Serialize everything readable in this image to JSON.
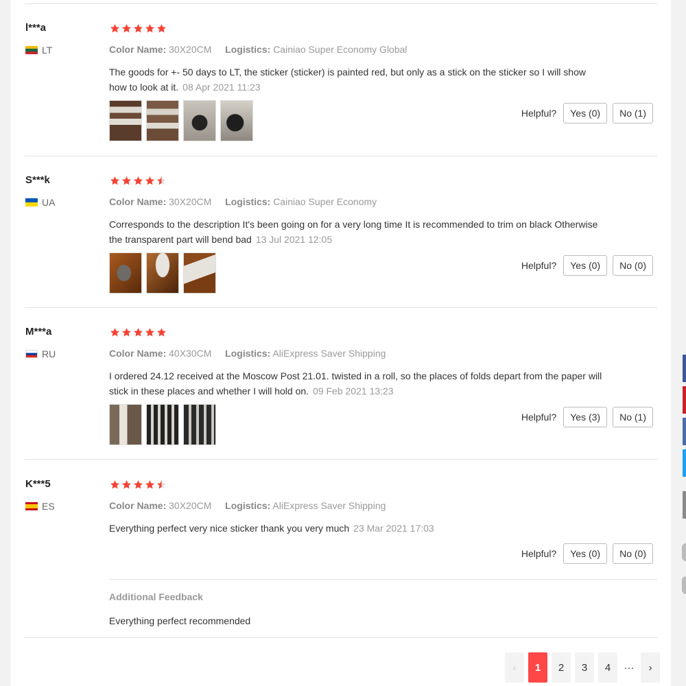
{
  "helpful_label": "Helpful?",
  "reviews": [
    {
      "user": "l***a",
      "country": "LT",
      "meta_color_label": "Color Name:",
      "color": "30X20CM",
      "meta_logistics_label": "Logistics:",
      "logistics": "Cainiao Super Economy Global",
      "text": "The goods for +- 50 days to LT, the sticker (sticker) is painted red, but only as a stick on the sticker so I will show how to look at it.",
      "date": "08 Apr 2021 11:23",
      "stars": 5,
      "yes": "Yes (0)",
      "no": "No (1)"
    },
    {
      "user": "S***k",
      "country": "UA",
      "meta_color_label": "Color Name:",
      "color": "30X20CM",
      "meta_logistics_label": "Logistics:",
      "logistics": "Cainiao Super Economy",
      "text": "Corresponds to the description It's been going on for a very long time It is recommended to trim on black Otherwise the transparent part will bend bad",
      "date": "13 Jul 2021 12:05",
      "stars": 4.5,
      "yes": "Yes (0)",
      "no": "No (0)"
    },
    {
      "user": "M***a",
      "country": "RU",
      "meta_color_label": "Color Name:",
      "color": "40X30CM",
      "meta_logistics_label": "Logistics:",
      "logistics": "AliExpress Saver Shipping",
      "text": "I ordered 24.12 received at the Moscow Post 21.01. twisted in a roll, so the places of folds depart from the paper will stick in these places and whether I will hold on.",
      "date": "09 Feb 2021 13:23",
      "stars": 5,
      "yes": "Yes (3)",
      "no": "No (1)"
    },
    {
      "user": "K***5",
      "country": "ES",
      "meta_color_label": "Color Name:",
      "color": "30X20CM",
      "meta_logistics_label": "Logistics:",
      "logistics": "AliExpress Saver Shipping",
      "text": "Everything perfect very nice sticker thank you very much",
      "date": "23 Mar 2021 17:03",
      "stars": 4.5,
      "yes": "Yes (0)",
      "no": "No (0)",
      "additional_title": "Additional Feedback",
      "additional_text": "Everything perfect recommended"
    }
  ],
  "pagination": {
    "prev": "‹",
    "pages": [
      "1",
      "2",
      "3",
      "4"
    ],
    "ellipsis": "···",
    "next": "›",
    "active": "1"
  },
  "colors": {
    "accent": "#ff4747",
    "star": "#f44336"
  }
}
